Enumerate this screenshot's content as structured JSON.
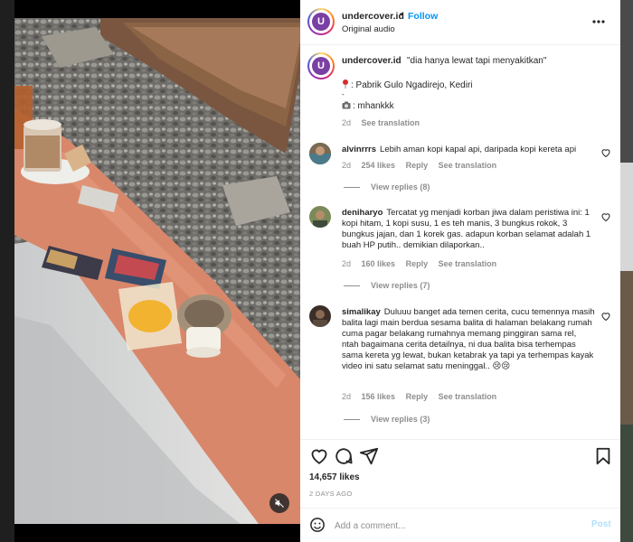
{
  "header": {
    "username": "undercover.id",
    "dot": "•",
    "follow_label": "Follow",
    "audio": "Original audio",
    "avatar_letter": "U"
  },
  "caption": {
    "username": "undercover.id",
    "text": "\"dia hanya lewat tapi menyakitkan\"",
    "location": ": Pabrik Gulo Ngadirejo, Kediri",
    "credit": ": mhankkk",
    "time": "2d",
    "see_translation": "See translation",
    "dash": "-"
  },
  "comments": [
    {
      "username": "alvinrrrs",
      "text": "Lebih aman kopi kapal api, daripada kopi kereta api",
      "time": "2d",
      "likes": "254 likes",
      "reply": "Reply",
      "see_translation": "See translation",
      "view_replies": "View replies (8)"
    },
    {
      "username": "deniharyo",
      "text": "Tercatat yg menjadi korban jiwa dalam peristiwa ini: 1 kopi hitam, 1 kopi susu, 1 es teh manis, 3 bungkus rokok, 3 bungkus jajan, dan 1 korek gas. adapun korban selamat adalah 1 buah HP putih.. demikian dilaporkan..",
      "time": "2d",
      "likes": "160 likes",
      "reply": "Reply",
      "see_translation": "See translation",
      "view_replies": "View replies (7)"
    },
    {
      "username": "simalikay",
      "text": "Duluuu banget ada temen cerita, cucu temennya masih balita lagi main berdua sesama balita di halaman belakang rumah cuma pagar belakang rumahnya memang pinggiran sama rel, ntah bagaimana cerita detailnya, ni dua balita bisa terhempas sama kereta yg lewat, bukan ketabrak ya tapi ya terhempas kayak video ini satu selamat satu meninggal.. 😢😢",
      "time": "2d",
      "likes": "156 likes",
      "reply": "Reply",
      "see_translation": "See translation",
      "view_replies": "View replies (3)"
    }
  ],
  "actions": {
    "likes": "14,657 likes",
    "date": "2 DAYS AGO"
  },
  "comment_box": {
    "placeholder": "Add a comment...",
    "post_label": "Post"
  },
  "colors": {
    "accent": "#0095f6",
    "muted": "#8e8e8e",
    "text": "#262626"
  },
  "icons": {
    "more": "more-horizontal-icon",
    "heart": "heart-icon",
    "comment": "comment-icon",
    "share": "share-icon",
    "bookmark": "bookmark-icon",
    "emoji": "emoji-icon",
    "mute": "mute-icon",
    "pin": "pin-icon",
    "camera": "camera-icon"
  }
}
